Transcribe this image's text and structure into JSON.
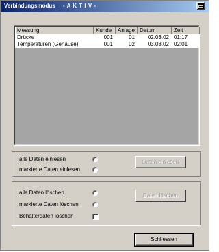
{
  "window": {
    "title": "Verbindungsmodus",
    "status": "- A K T I V -"
  },
  "table": {
    "columns": [
      "Messung",
      "Kunde",
      "Anlage",
      "Datum",
      "Zeit"
    ],
    "rows": [
      [
        "Drücke",
        "001",
        "01",
        "02.03.02",
        "01:17"
      ],
      [
        "Temperaturen (Gehäuse)",
        "001",
        "02",
        "03.03.02",
        "02:01"
      ]
    ]
  },
  "read_group": {
    "option_all": "alle Daten einlesen",
    "option_marked": "markierte Daten einlesen",
    "button": "Daten einlesen"
  },
  "delete_group": {
    "option_all": "alle Daten löschen",
    "option_marked": "markierte Daten löschen",
    "option_container": "Behälterdaten löschen",
    "button": "Daten löschen"
  },
  "close_button": {
    "hotkey": "S",
    "rest": "chliessen"
  }
}
